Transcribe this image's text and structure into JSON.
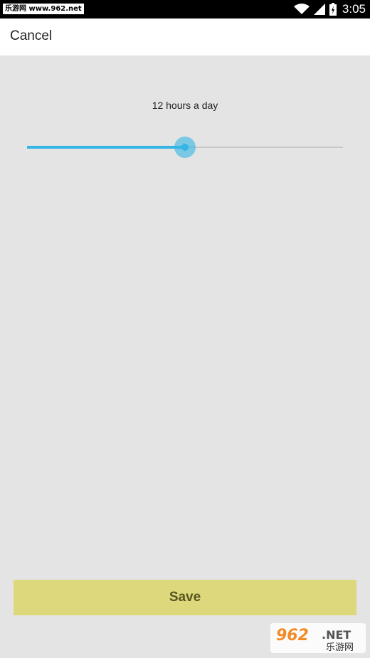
{
  "status_bar": {
    "watermark": "乐游网 www.962.net",
    "time": "3:05",
    "icons": [
      "wifi-icon",
      "signal-icon",
      "battery-icon"
    ]
  },
  "app_bar": {
    "cancel_label": "Cancel"
  },
  "main": {
    "hours_label": "12 hours a day",
    "slider": {
      "value_fraction": 0.5,
      "accent_color": "#33b5e5"
    }
  },
  "footer": {
    "save_label": "Save",
    "save_color": "#dcd87b"
  },
  "watermark_logo": {
    "brand": "962.NET",
    "subtitle": "乐游网"
  }
}
